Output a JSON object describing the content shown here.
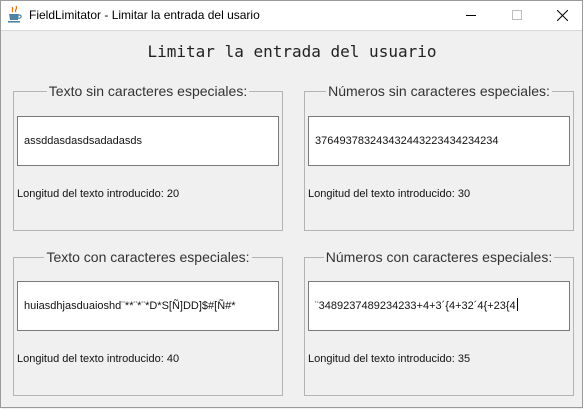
{
  "window": {
    "title": "FieldLimitator - Limitar la entrada del usario",
    "icons": {
      "app": "java-cup-icon",
      "minimize": "minimize-icon",
      "maximize": "maximize-icon",
      "close": "close-icon"
    }
  },
  "main": {
    "heading": "Limitar la entrada del usuario"
  },
  "panels": [
    {
      "title": "Texto sin caracteres especiales:",
      "value": "assddasdasdsadadasds",
      "length_label": "Longitud del texto introducido: 20",
      "has_caret": false
    },
    {
      "title": "Números sin caracteres especiales:",
      "value": "376493783243432443223434234234",
      "length_label": "Longitud del texto introducido: 30",
      "has_caret": false
    },
    {
      "title": "Texto con caracteres especiales:",
      "value": "huiasdhjasduaioshd¨**¨*¨*D*S[Ñ]DD]$#[Ñ#*",
      "length_label": "Longitud del texto introducido: 40",
      "has_caret": false
    },
    {
      "title": "Números con caracteres especiales:",
      "value": "¨3489237489234233+4+3´{4+32´4{+23{4",
      "length_label": "Longitud del texto introducido: 35",
      "has_caret": true
    }
  ],
  "colors": {
    "window_bg": "#f0f0f0",
    "titlebar_bg": "#ffffff",
    "field_border": "#7a7a7a",
    "panel_border": "#b4b4b4"
  }
}
